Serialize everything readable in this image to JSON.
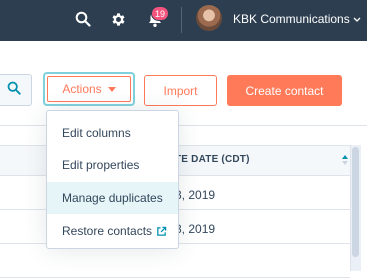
{
  "topbar": {
    "notification_count": "19",
    "account_name": "KBK Communications",
    "icons": [
      "search-icon",
      "gear-icon",
      "bell-icon",
      "chevron-down-icon"
    ]
  },
  "toolbar": {
    "actions_label": "Actions",
    "import_label": "Import",
    "create_label": "Create contact"
  },
  "actions_menu": {
    "items": [
      {
        "label": "Edit columns"
      },
      {
        "label": "Edit properties"
      },
      {
        "label": "Manage duplicates",
        "highlighted": true
      },
      {
        "label": "Restore contacts",
        "icon": "external-link-icon"
      }
    ]
  },
  "table": {
    "header_partial": "TE DATE (CDT)",
    "rows": [
      {
        "date_partial": "3, 2019"
      },
      {
        "date_partial": "3, 2019"
      }
    ]
  },
  "colors": {
    "topbar": "#2d3e50",
    "accent": "#ff7a59",
    "focus_ring": "#7fd1de",
    "badge": "#f2547d",
    "menu_highlight": "#e5f5f8"
  }
}
